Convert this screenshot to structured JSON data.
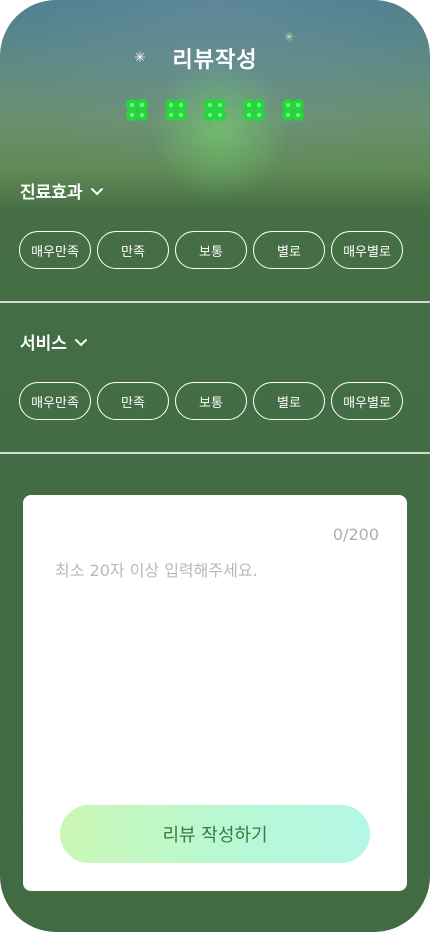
{
  "header": {
    "title": "리뷰작성"
  },
  "rating": {
    "value": 5,
    "max": 5,
    "icon": "clover-icon",
    "color": "#22d83a"
  },
  "sections": [
    {
      "title": "진료효과",
      "options": [
        "매우만족",
        "만족",
        "보통",
        "별로",
        "매우별로"
      ]
    },
    {
      "title": "서비스",
      "options": [
        "매우만족",
        "만족",
        "보통",
        "별로",
        "매우별로"
      ]
    }
  ],
  "review": {
    "counter": "0/200",
    "placeholder": "최소 20자 이상 입력해주세요.",
    "submit_label": "리뷰 작성하기"
  },
  "colors": {
    "background": "#416b42",
    "accent": "#3a7a3f"
  }
}
